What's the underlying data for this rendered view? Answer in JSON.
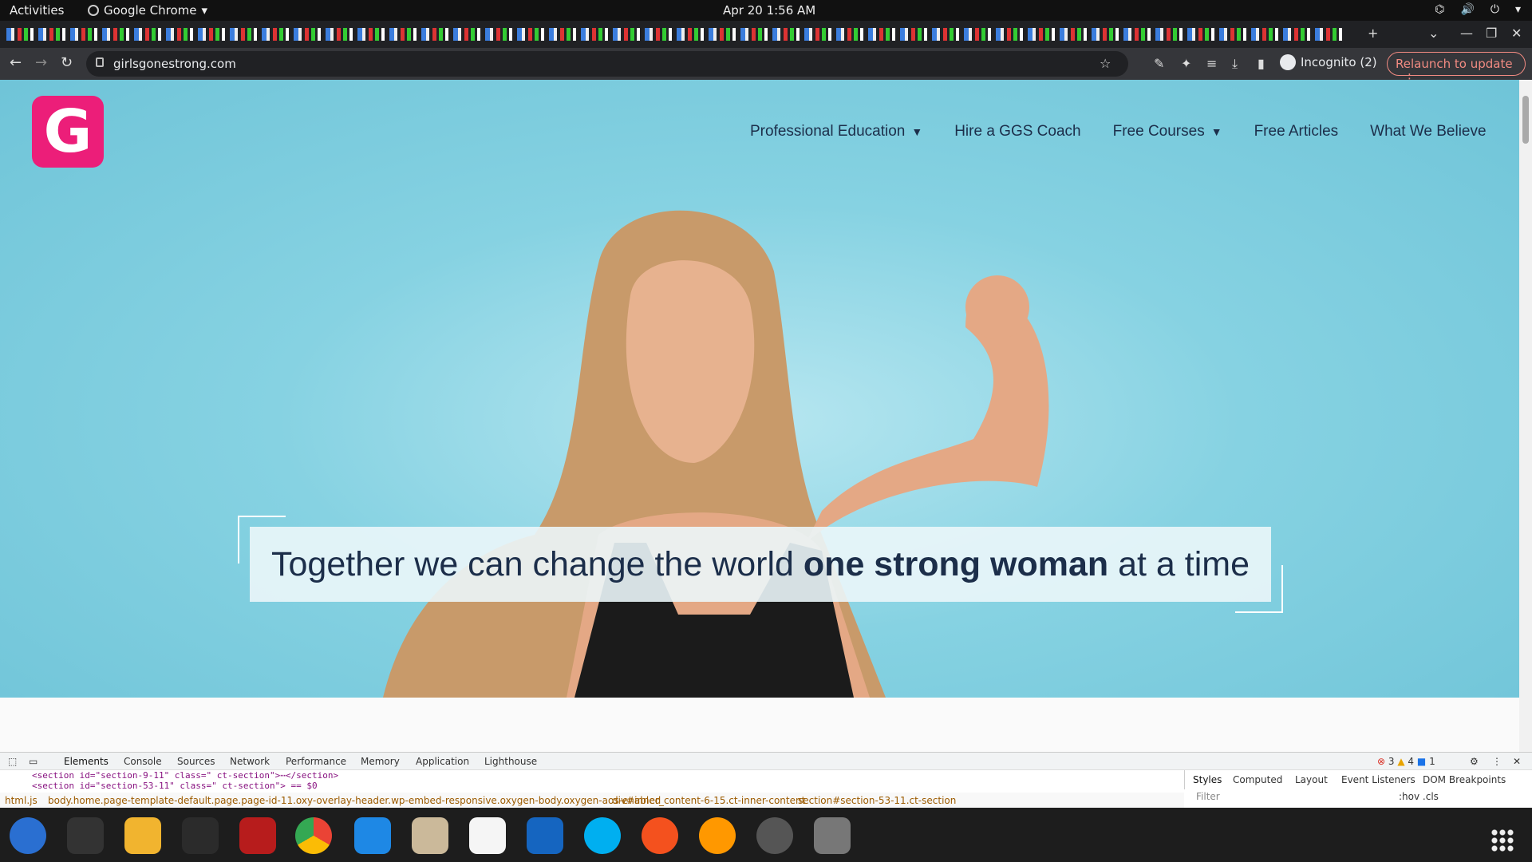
{
  "system": {
    "activities": "Activities",
    "app_name": "Google Chrome",
    "clock": "Apr 20  1:56 AM"
  },
  "browser": {
    "url": "girlsgonestrong.com",
    "incognito_label": "Incognito (2)",
    "relaunch_label": "Relaunch to update"
  },
  "site": {
    "logo_letter": "G",
    "logo_color": "#ec1e79",
    "nav": [
      {
        "label": "Professional Education",
        "dropdown": true
      },
      {
        "label": "Hire a GGS Coach",
        "dropdown": false
      },
      {
        "label": "Free Courses",
        "dropdown": true
      },
      {
        "label": "Free Articles",
        "dropdown": false
      },
      {
        "label": "What We Believe",
        "dropdown": false
      }
    ],
    "hero_quote": {
      "before": "Together we can change the world ",
      "bold": "one strong woman",
      "after": " at a time"
    }
  },
  "devtools": {
    "tabs": [
      "Elements",
      "Console",
      "Sources",
      "Network",
      "Performance",
      "Memory",
      "Application",
      "Lighthouse"
    ],
    "code_line1": "<section id=\"section-9-11\" class=\" ct-section\">⋯</section>",
    "code_line2": "<section id=\"section-53-11\" class=\" ct-section\"> == $0",
    "breadcrumbs": [
      "html.js",
      "body.home.page-template-default.page.page-id-11.oxy-overlay-header.wp-embed-responsive.oxygen-body.oxygen-aos-enabled",
      "div#inner_content-6-15.ct-inner-content",
      "section#section-53-11.ct-section"
    ],
    "side_tabs": [
      "Styles",
      "Computed",
      "Layout",
      "Event Listeners",
      "DOM Breakpoints"
    ],
    "errors": "3",
    "warnings": "4",
    "infos": "1",
    "filter_placeholder": "Filter",
    "hov_cls": ":hov .cls"
  },
  "dock_apps": [
    "thunderbird",
    "terminal",
    "calculator",
    "system-monitor",
    "filezilla",
    "chrome",
    "vscode",
    "files",
    "text-editor",
    "libreoffice-writer",
    "skype",
    "inkscape",
    "firefox-dev",
    "settings",
    "disk"
  ]
}
